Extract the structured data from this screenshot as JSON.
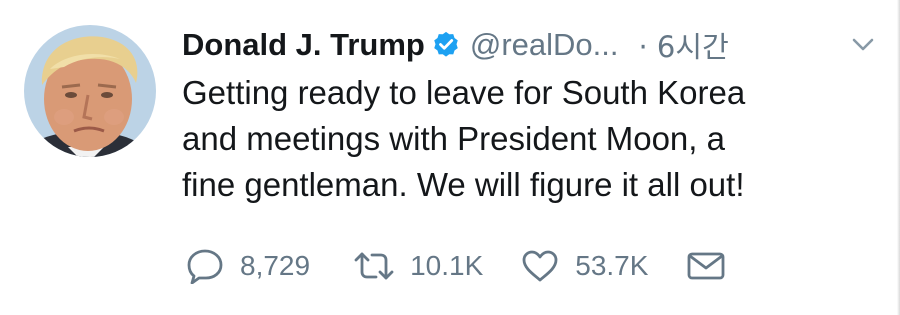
{
  "tweet": {
    "author_name": "Donald J. Trump",
    "handle": "@realDo...",
    "time": "· 6시간",
    "text_lines": [
      "Getting ready to leave for South Korea",
      "and meetings with President Moon, a",
      "fine gentleman. We will figure it all out!"
    ],
    "verified_icon": "verified-badge-icon",
    "menu_icon": "chevron-down-icon"
  },
  "actions": {
    "reply_count": "8,729",
    "retweet_count": "10.1K",
    "like_count": "53.7K",
    "icons": [
      "reply-icon",
      "retweet-icon",
      "like-icon",
      "direct-message-icon"
    ]
  },
  "colors": {
    "text": "#14171a",
    "secondary": "#657786",
    "verified": "#1da1f2",
    "background": "#ffffff"
  }
}
